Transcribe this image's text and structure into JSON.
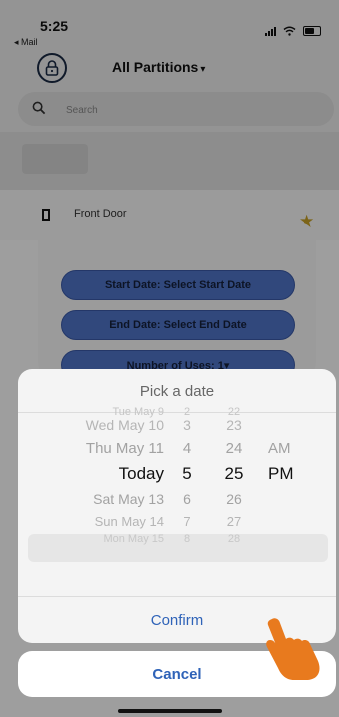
{
  "status_bar": {
    "time": "5:25",
    "back_app": "◂ Mail"
  },
  "header": {
    "title": "All Partitions",
    "caret": "▾"
  },
  "search": {
    "placeholder": "Search"
  },
  "door": {
    "label": "Front Door"
  },
  "modal": {
    "start_label": "Start Date: Select Start Date",
    "end_label": "End Date: Select End Date",
    "uses_label": "Number of Uses: 1▾"
  },
  "picker": {
    "title": "Pick a date",
    "dates": [
      "Tue May 9",
      "Wed May 10",
      "Thu May 11",
      "Today",
      "Sat May 13",
      "Sun May 14",
      "Mon May 15"
    ],
    "hours": [
      "2",
      "3",
      "4",
      "5",
      "6",
      "7",
      "8"
    ],
    "minutes": [
      "22",
      "23",
      "24",
      "25",
      "26",
      "27",
      "28"
    ],
    "ampm": [
      "AM",
      "PM"
    ],
    "confirm_label": "Confirm"
  },
  "cancel_label": "Cancel",
  "colors": {
    "accent": "#2f63b8",
    "button": "#4f74c9",
    "star": "#c9a227",
    "hand": "#e87a1e"
  }
}
